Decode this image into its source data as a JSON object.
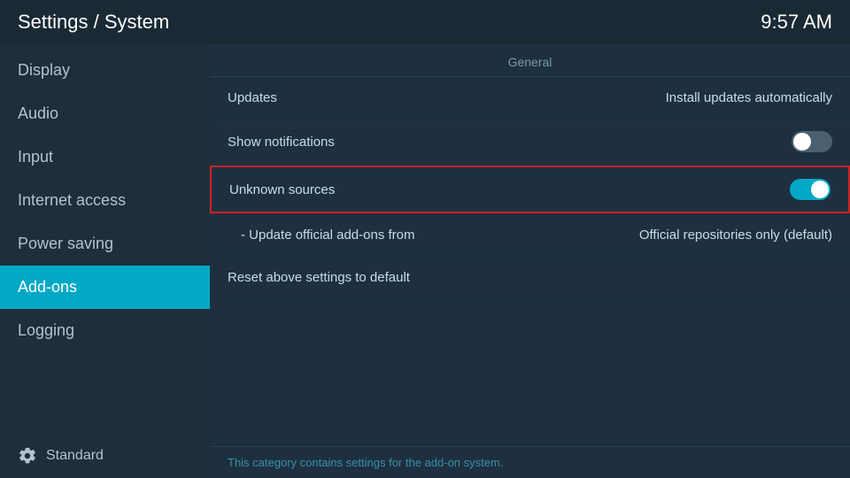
{
  "header": {
    "title": "Settings / System",
    "time": "9:57 AM"
  },
  "sidebar": {
    "items": [
      {
        "id": "display",
        "label": "Display",
        "active": false
      },
      {
        "id": "audio",
        "label": "Audio",
        "active": false
      },
      {
        "id": "input",
        "label": "Input",
        "active": false
      },
      {
        "id": "internet-access",
        "label": "Internet access",
        "active": false
      },
      {
        "id": "power-saving",
        "label": "Power saving",
        "active": false
      },
      {
        "id": "add-ons",
        "label": "Add-ons",
        "active": true
      },
      {
        "id": "logging",
        "label": "Logging",
        "active": false
      }
    ],
    "footer_label": "Standard"
  },
  "content": {
    "section_label": "General",
    "settings": [
      {
        "id": "updates",
        "label": "Updates",
        "value": "Install updates automatically",
        "type": "value",
        "sub": false,
        "highlighted": false
      },
      {
        "id": "show-notifications",
        "label": "Show notifications",
        "value": "",
        "type": "toggle",
        "toggle_state": "off",
        "sub": false,
        "highlighted": false
      },
      {
        "id": "unknown-sources",
        "label": "Unknown sources",
        "value": "",
        "type": "toggle",
        "toggle_state": "on",
        "sub": false,
        "highlighted": true
      },
      {
        "id": "update-official-addons",
        "label": "- Update official add-ons from",
        "value": "Official repositories only (default)",
        "type": "value",
        "sub": true,
        "highlighted": false
      },
      {
        "id": "reset-settings",
        "label": "Reset above settings to default",
        "value": "",
        "type": "button",
        "sub": false,
        "highlighted": false
      }
    ],
    "footer_text": "This category contains settings for the add-on system."
  }
}
